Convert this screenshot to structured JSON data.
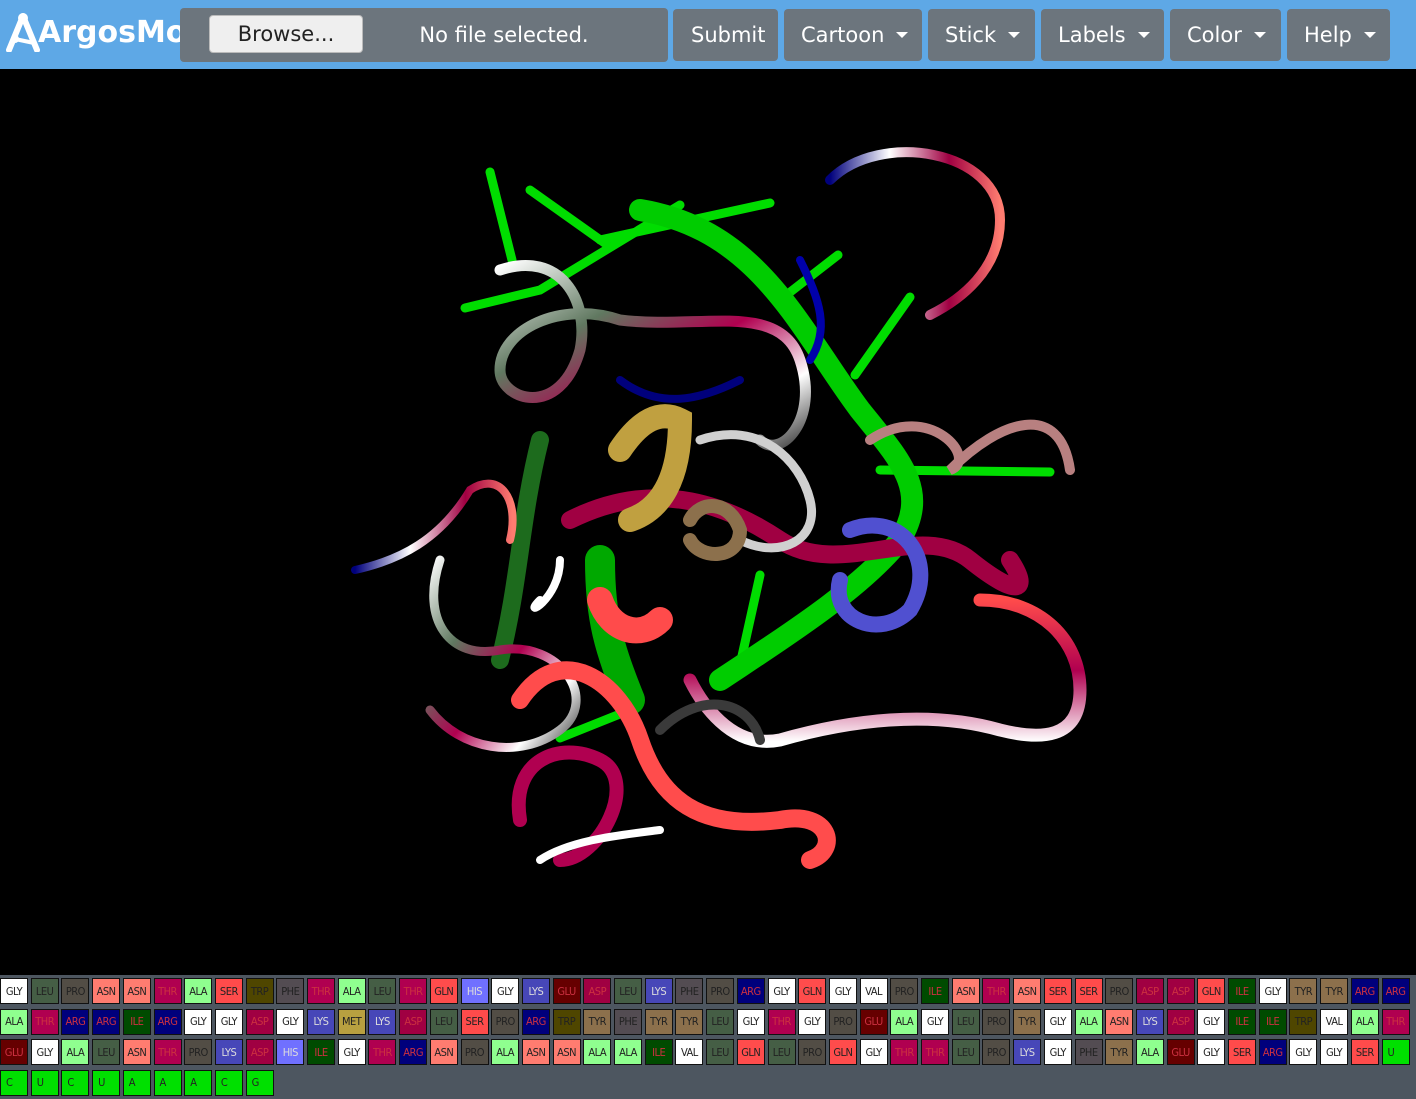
{
  "app": {
    "brand_name": "ArgosMol"
  },
  "toolbar": {
    "browse_label": "Browse...",
    "file_status": "No file selected.",
    "submit_label": "Submit",
    "menus": [
      {
        "label": "Cartoon"
      },
      {
        "label": "Stick"
      },
      {
        "label": "Labels"
      },
      {
        "label": "Color"
      },
      {
        "label": "Help"
      }
    ]
  },
  "colors": {
    "navbar": "#5ea8e6",
    "button": "#6c757d",
    "GLY": "#ffffff",
    "ALA": "#8fff8f",
    "SER": "#ff4b4b",
    "THR": "#b00050",
    "CYS": "#ffff70",
    "VAL": "#ffffff",
    "LEU": "#455e45",
    "ILE": "#004b00",
    "MET": "#b8a040",
    "PRO": "#524d45",
    "PHE": "#534c52",
    "TYR": "#8c704c",
    "TRP": "#4f4600",
    "ASP": "#a00042",
    "GLU": "#660000",
    "ASN": "#ff7c70",
    "GLN": "#ff4c4c",
    "LYS": "#4747b8",
    "ARG": "#00007c",
    "HIS": "#7070ff",
    "NUC": "#00e000"
  },
  "sequence": [
    [
      "GLY",
      "LEU",
      "PRO",
      "ASN",
      "ASN",
      "THR",
      "ALA",
      "SER",
      "TRP",
      "PHE",
      "THR",
      "ALA",
      "LEU",
      "THR",
      "GLN",
      "HIS",
      "GLY",
      "LYS",
      "GLU",
      "ASP",
      "LEU",
      "LYS",
      "PHE",
      "PRO",
      "ARG",
      "GLY",
      "GLN",
      "GLY",
      "VAL",
      "PRO",
      "ILE",
      "ASN",
      "THR",
      "ASN",
      "SER",
      "SER",
      "PRO",
      "ASP",
      "ASP",
      "GLN",
      "ILE",
      "GLY",
      "TYR",
      "TYR",
      "ARG",
      "ARG"
    ],
    [
      "ALA",
      "THR",
      "ARG",
      "ARG",
      "ILE",
      "ARG",
      "GLY",
      "GLY",
      "ASP",
      "GLY",
      "LYS",
      "MET",
      "LYS",
      "ASP",
      "LEU",
      "SER",
      "PRO",
      "ARG",
      "TRP",
      "TYR",
      "PHE",
      "TYR",
      "TYR",
      "LEU",
      "GLY",
      "THR",
      "GLY",
      "PRO",
      "GLU",
      "ALA",
      "GLY",
      "LEU",
      "PRO",
      "TYR",
      "GLY",
      "ALA",
      "ASN",
      "LYS",
      "ASP",
      "GLY",
      "ILE",
      "ILE",
      "TRP",
      "VAL",
      "ALA",
      "THR"
    ],
    [
      "GLU",
      "GLY",
      "ALA",
      "LEU",
      "ASN",
      "THR",
      "PRO",
      "LYS",
      "ASP",
      "HIS",
      "ILE",
      "GLY",
      "THR",
      "ARG",
      "ASN",
      "PRO",
      "ALA",
      "ASN",
      "ASN",
      "ALA",
      "ALA",
      "ILE",
      "VAL",
      "LEU",
      "GLN",
      "LEU",
      "PRO",
      "GLN",
      "GLY",
      "THR",
      "THR",
      "LEU",
      "PRO",
      "LYS",
      "GLY",
      "PHE",
      "TYR",
      "ALA",
      "GLU",
      "GLY",
      "SER",
      "ARG",
      "GLY",
      "GLY",
      "SER",
      "U"
    ],
    [
      "C",
      "U",
      "C",
      "U",
      "A",
      "A",
      "A",
      "C",
      "G"
    ]
  ]
}
